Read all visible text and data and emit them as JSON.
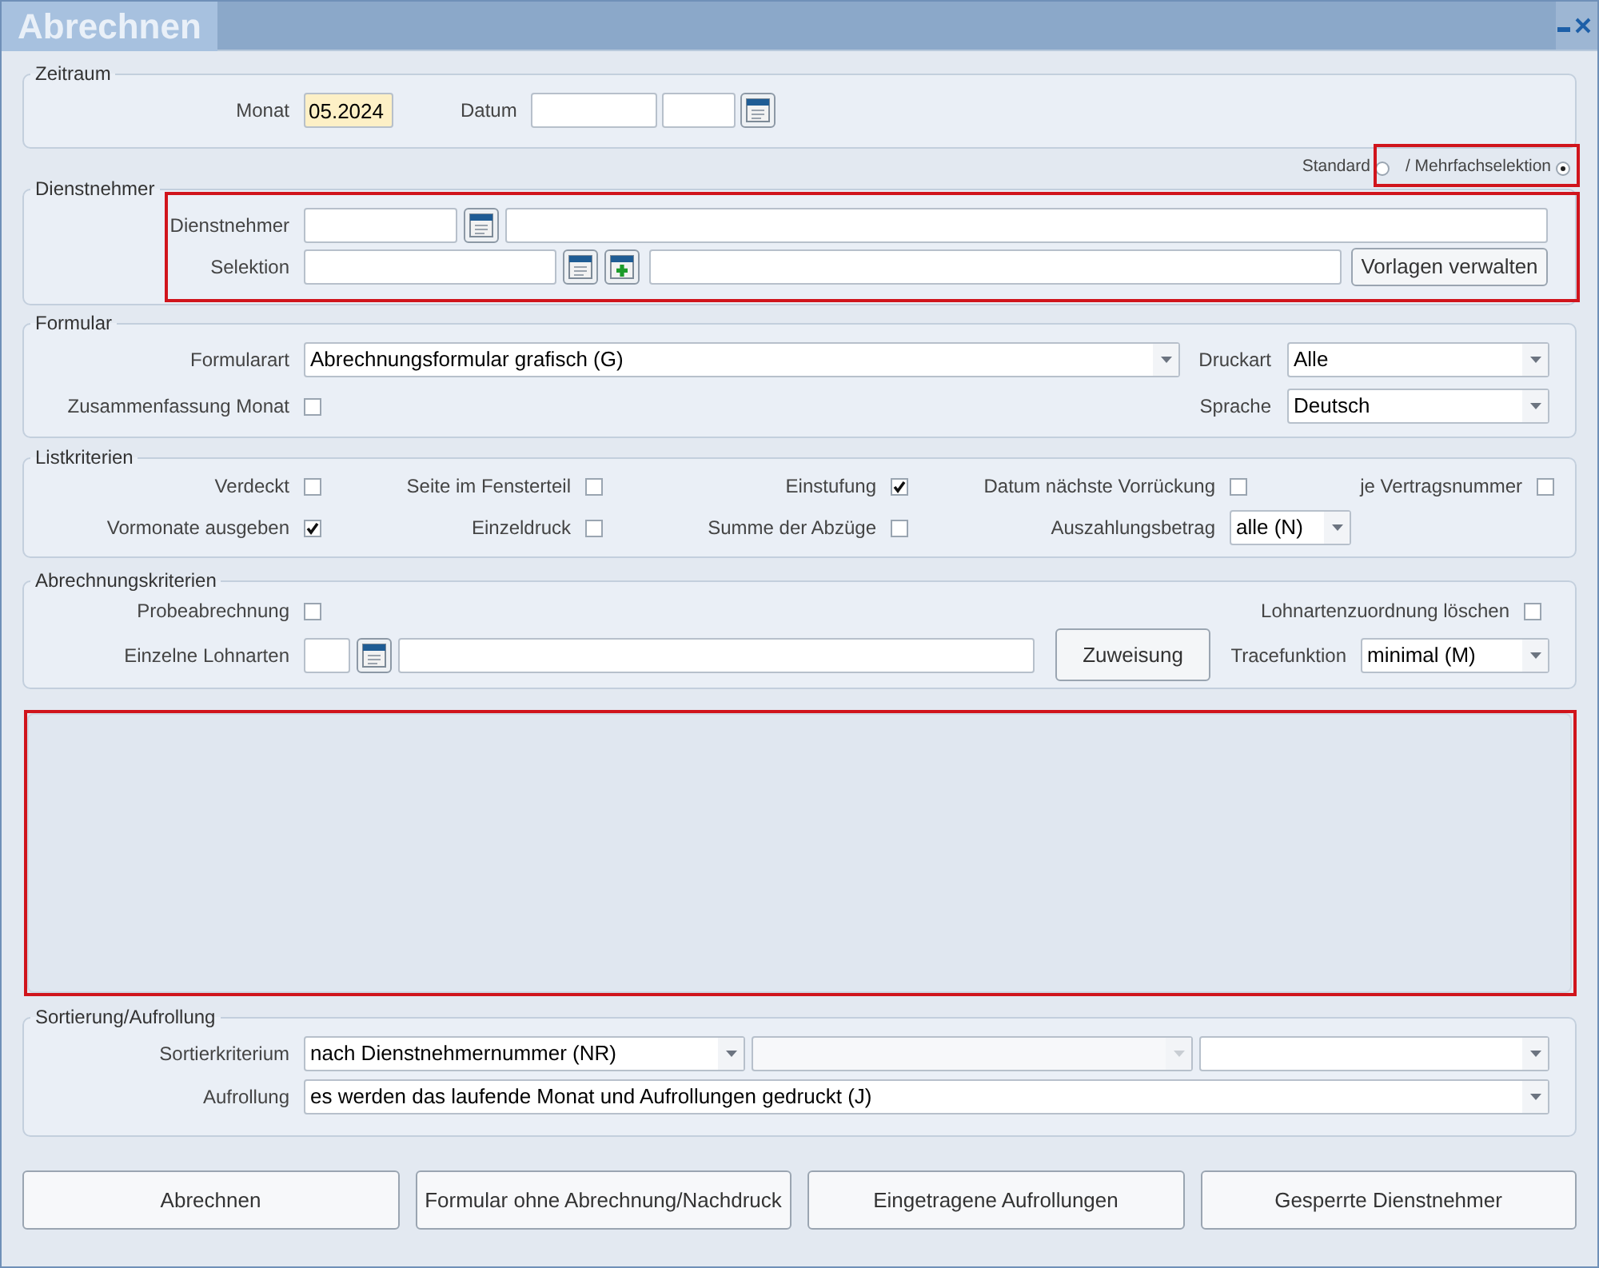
{
  "window": {
    "title": "Abrechnen"
  },
  "zeitraum": {
    "legend": "Zeitraum",
    "monat": {
      "label": "Monat",
      "value": "05.2024"
    },
    "datum": {
      "label": "Datum"
    }
  },
  "selection_mode": [
    {
      "label": "Standard",
      "selected": false
    },
    {
      "label": "/ Mehrfachselektion",
      "selected": true
    }
  ],
  "dienstnehmer": {
    "legend": "Dienstnehmer",
    "rows": [
      {
        "label": "Dienstnehmer"
      },
      {
        "label": "Selektion",
        "button": "Vorlagen verwalten"
      }
    ]
  },
  "formular": {
    "legend": "Formular",
    "formularart": {
      "label": "Formularart",
      "value": "Abrechnungsformular grafisch (G)"
    },
    "zusammenfassung": {
      "label": "Zusammenfassung Monat",
      "checked": false
    },
    "druckart": {
      "label": "Druckart",
      "value": "Alle"
    },
    "sprache": {
      "label": "Sprache",
      "value": "Deutsch"
    }
  },
  "listkriterien": {
    "legend": "Listkriterien",
    "rows": [
      [
        {
          "kind": "checkbox",
          "label": "Verdeckt",
          "checked": false
        },
        {
          "kind": "checkbox",
          "label": "Seite im Fensterteil",
          "checked": false
        },
        {
          "kind": "checkbox",
          "label": "Einstufung",
          "checked": true
        },
        {
          "kind": "checkbox",
          "label": "Datum nächste Vorrückung",
          "checked": false
        },
        {
          "kind": "checkbox",
          "label": "je Vertragsnummer",
          "checked": false
        }
      ],
      [
        {
          "kind": "checkbox",
          "label": "Vormonate ausgeben",
          "checked": true
        },
        {
          "kind": "checkbox",
          "label": "Einzeldruck",
          "checked": false
        },
        {
          "kind": "checkbox",
          "label": "Summe der Abzüge",
          "checked": false
        },
        {
          "kind": "select",
          "label": "Auszahlungsbetrag",
          "value": "alle (N)"
        }
      ]
    ]
  },
  "abrechnungskriterien": {
    "legend": "Abrechnungskriterien",
    "probeabrechnung": {
      "label": "Probeabrechnung",
      "checked": false
    },
    "lohnartenzuordnung": {
      "label": "Lohnartenzuordnung löschen",
      "checked": false
    },
    "lohnarten": {
      "label": "Einzelne Lohnarten",
      "button": "Zuweisung"
    },
    "tracefunktion": {
      "label": "Tracefunktion",
      "value": "minimal (M)"
    }
  },
  "sortierung": {
    "legend": "Sortierung/Aufrollung",
    "sortierkriterium": {
      "label": "Sortierkriterium",
      "selects": [
        {
          "value": "nach Dienstnehmernummer (NR)",
          "disabled": false
        },
        {
          "disabled": true
        },
        {
          "disabled": false
        }
      ]
    },
    "aufrollung": {
      "label": "Aufrollung",
      "value": "es werden das laufende Monat und Aufrollungen gedruckt (J)"
    }
  },
  "buttons": [
    "Abrechnen",
    "Formular ohne Abrechnung/Nachdruck",
    "Eingetragene Aufrollungen",
    "Gesperrte Dienstnehmer"
  ]
}
